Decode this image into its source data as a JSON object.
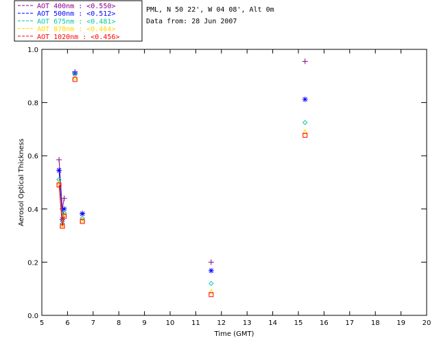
{
  "header": {
    "line1": "PML, N 50 22', W 04 08', Alt 0m",
    "line2": "Data from: 28 Jun 2007"
  },
  "chart_data": {
    "type": "scatter",
    "title": "",
    "xlabel": "Time (GMT)",
    "ylabel": "Aerosol Optical Thickness",
    "xlim": [
      5,
      20
    ],
    "ylim": [
      0.0,
      1.0
    ],
    "xticks": [
      5,
      6,
      7,
      8,
      9,
      10,
      11,
      12,
      13,
      14,
      15,
      16,
      17,
      18,
      19,
      20
    ],
    "yticks": [
      0.0,
      0.2,
      0.4,
      0.6,
      0.8,
      1.0
    ],
    "ytick_labels": [
      "0.0",
      "0.2",
      "0.4",
      "0.6",
      "0.8",
      "1.0"
    ],
    "legend_position": "top-left",
    "series": [
      {
        "name": "AOT  400nm : <0.550>",
        "color": "#8b008b",
        "marker": "plus",
        "x": [
          5.67,
          5.8,
          5.87,
          6.29,
          6.58,
          11.6,
          15.26
        ],
        "y": [
          0.585,
          0.4,
          0.44,
          0.915,
          0.383,
          0.2,
          0.955
        ]
      },
      {
        "name": "AOT  500nm : <0.512>",
        "color": "#0000ff",
        "marker": "asterisk",
        "x": [
          5.67,
          5.8,
          5.87,
          6.29,
          6.58,
          11.6,
          15.26
        ],
        "y": [
          0.545,
          0.36,
          0.4,
          0.91,
          0.382,
          0.168,
          0.812
        ]
      },
      {
        "name": "AOT  675nm : <0.481>",
        "color": "#00c8a0",
        "marker": "diamond",
        "x": [
          5.67,
          5.8,
          5.87,
          6.29,
          6.58,
          11.6,
          15.26
        ],
        "y": [
          0.51,
          0.345,
          0.385,
          0.905,
          0.365,
          0.12,
          0.725
        ]
      },
      {
        "name": "AOT  870nm : <0.464>",
        "color": "#ffd700",
        "marker": "triangle",
        "x": [
          5.67,
          5.8,
          5.87,
          6.29,
          6.58,
          11.6,
          15.26
        ],
        "y": [
          0.5,
          0.34,
          0.378,
          0.893,
          0.358,
          0.09,
          0.69
        ]
      },
      {
        "name": "AOT 1020nm : <0.456>",
        "color": "#ff0000",
        "marker": "square",
        "x": [
          5.67,
          5.8,
          5.87,
          6.29,
          6.58,
          11.6,
          15.26
        ],
        "y": [
          0.49,
          0.335,
          0.373,
          0.887,
          0.353,
          0.078,
          0.677
        ]
      }
    ]
  }
}
